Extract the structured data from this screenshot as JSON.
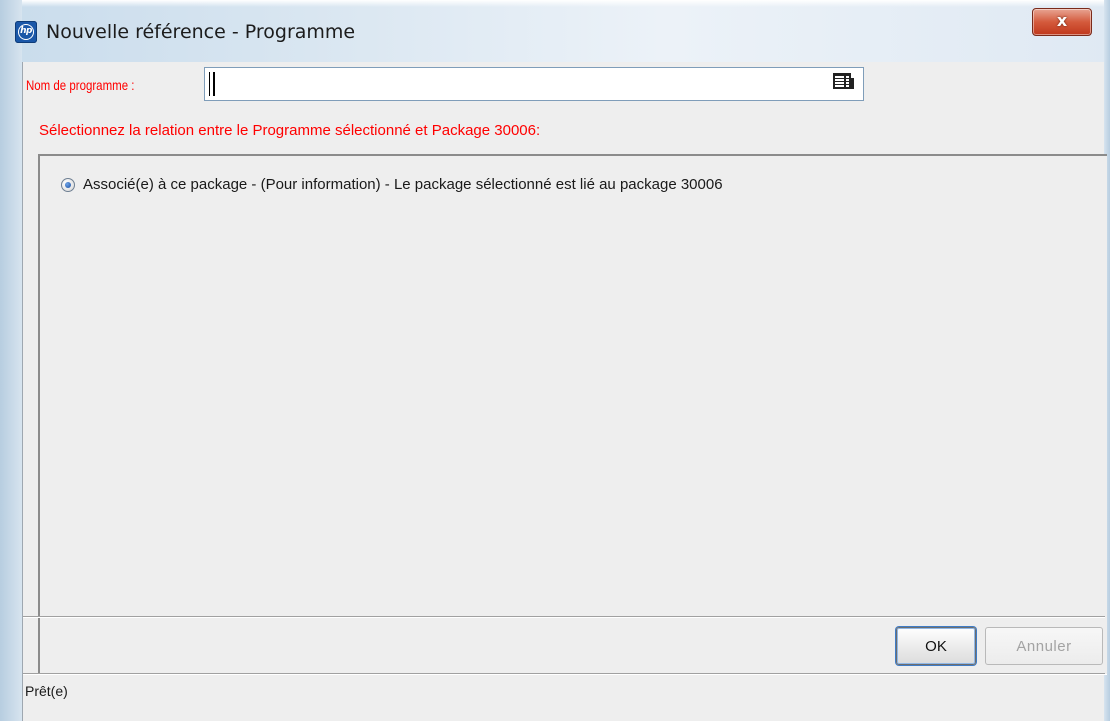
{
  "window": {
    "title": "Nouvelle référence - Programme",
    "close_label": "x",
    "app_icon_text": "hp"
  },
  "form": {
    "program_name_label": "Nom de programme :",
    "program_name_value": "",
    "lookup_icon": "list-lookup-icon",
    "instruction": "Sélectionnez la relation entre le Programme sélectionné et Package 30006:"
  },
  "relations": [
    {
      "label": "Associé(e) à ce package - (Pour information) - Le package sélectionné est lié au package 30006",
      "selected": true
    }
  ],
  "buttons": {
    "ok_label": "OK",
    "cancel_label": "Annuler",
    "cancel_enabled": false
  },
  "status": {
    "text": "Prêt(e)"
  },
  "colors": {
    "required_label": "#ff0000",
    "close_button": "#c9462a",
    "default_button_focus": "#3f7cc6"
  }
}
